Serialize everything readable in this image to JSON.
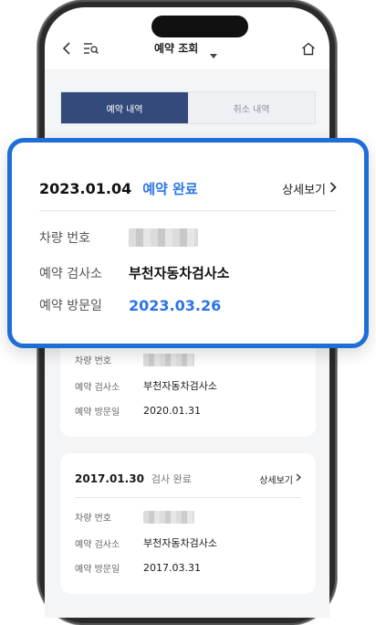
{
  "header": {
    "title": "예약 조회"
  },
  "tabs": [
    {
      "label": "예약 내역",
      "active": true
    },
    {
      "label": "취소 내역",
      "active": false
    }
  ],
  "labels": {
    "car_number": "차량 번호",
    "inspection_center": "예약 검사소",
    "visit_date": "예약 방문일",
    "detail": "상세보기"
  },
  "highlight": {
    "date": "2023.01.04",
    "status": "예약 완료",
    "center": "부천자동차검사소",
    "visit_date": "2023.03.26"
  },
  "records": [
    {
      "center": "부천자동차검사소",
      "visit_date": "2020.01.31"
    },
    {
      "date": "2017.01.30",
      "status": "검사 완료",
      "center": "부천자동차검사소",
      "visit_date": "2017.03.31"
    }
  ],
  "colors": {
    "accent": "#2b74e6",
    "tab_active": "#344a7a",
    "highlight_border": "#1e6ed8"
  },
  "icons": {
    "back": "chevron-left-icon",
    "menu": "menu-search-icon",
    "dropdown": "caret-down-icon",
    "home": "home-icon",
    "detail": "chevron-right-icon"
  }
}
